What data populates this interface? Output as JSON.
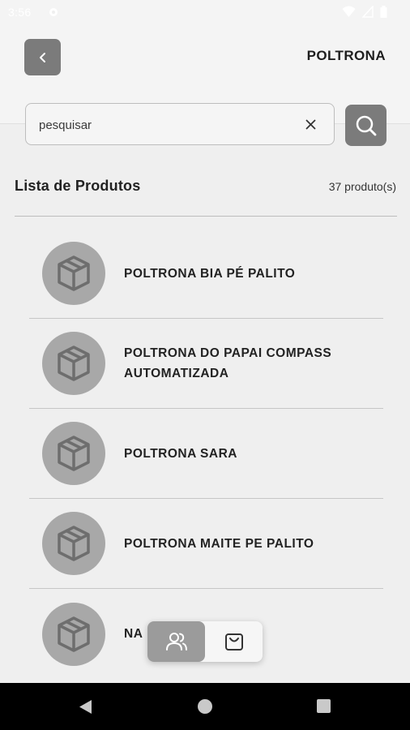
{
  "status_bar": {
    "time": "3:56"
  },
  "header": {
    "title": "POLTRONA",
    "back_icon": "chevron-left-icon"
  },
  "search": {
    "placeholder": "pesquisar",
    "value": "",
    "clear_icon": "close-icon",
    "search_icon": "search-icon"
  },
  "list": {
    "title": "Lista de Produtos",
    "count": "37 produto(s)",
    "items": [
      {
        "name": "POLTRONA BIA PÉ PALITO"
      },
      {
        "name": "POLTRONA DO PAPAI COMPASS AUTOMATIZADA"
      },
      {
        "name": "POLTRONA SARA"
      },
      {
        "name": "POLTRONA MAITE PE PALITO"
      },
      {
        "name": "NA"
      }
    ]
  },
  "floating_tabs": {
    "users_icon": "users-icon",
    "cart_icon": "shopping-bag-icon"
  },
  "colors": {
    "accent": "#7b7b7b",
    "background": "#efefef",
    "thumb": "#a8a8a8"
  }
}
